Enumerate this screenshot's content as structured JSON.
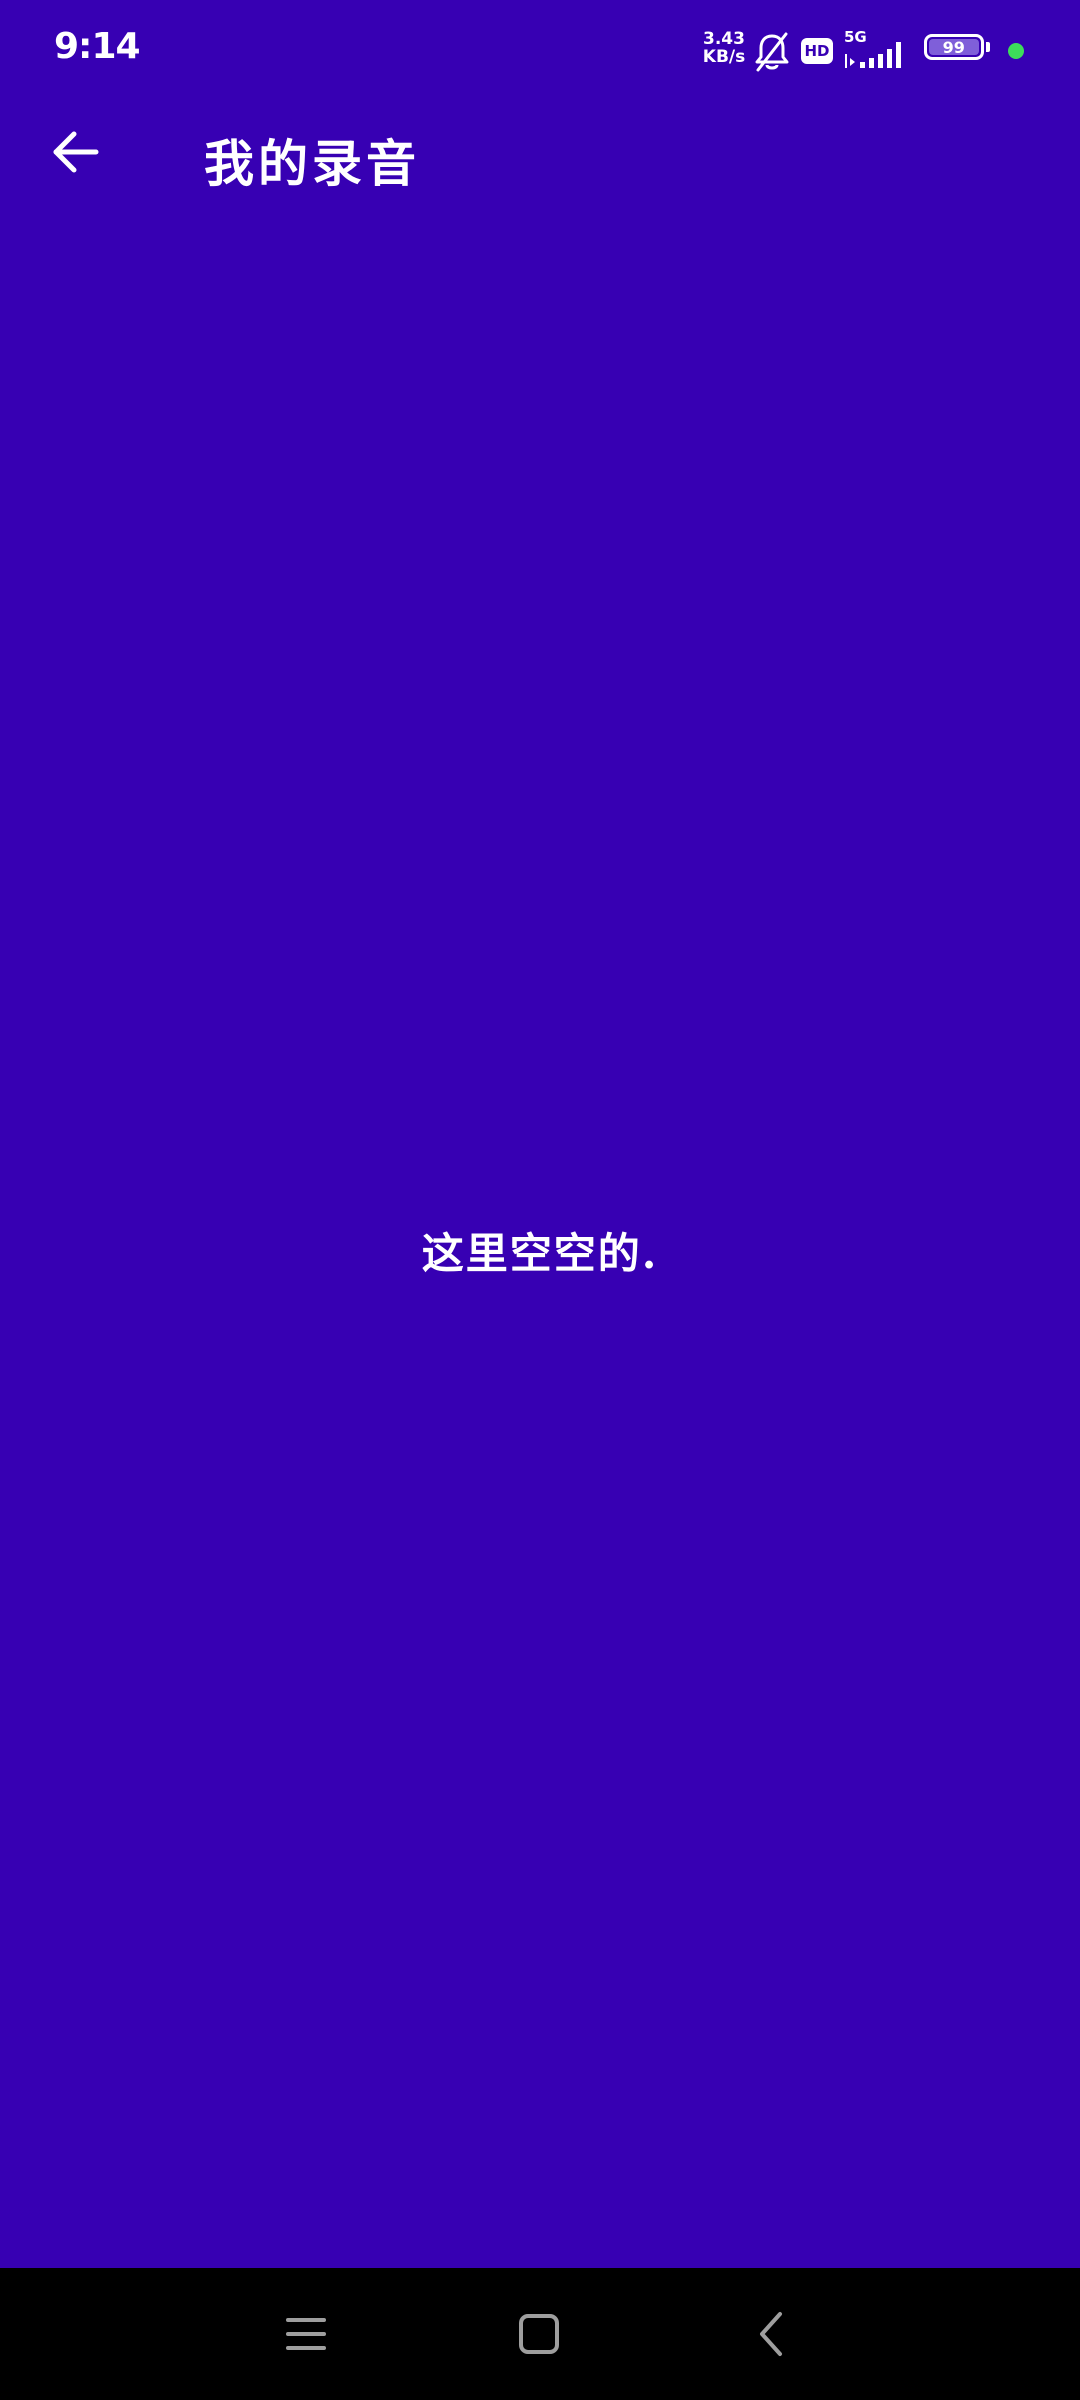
{
  "status_bar": {
    "time": "9:14",
    "net_speed_value": "3.43",
    "net_speed_unit": "KB/s",
    "hd_label": "HD",
    "network_type": "5G",
    "battery_level": "99",
    "icons": [
      "notifications-muted-icon",
      "hd-icon",
      "signal-icon",
      "battery-icon",
      "status-dot"
    ],
    "dot_color": "#3ddc5a"
  },
  "app_bar": {
    "title": "我的录音",
    "back_icon": "arrow-left-icon"
  },
  "main": {
    "empty_message": "这里空空的."
  },
  "nav_bar": {
    "buttons": [
      "menu-icon",
      "home-icon",
      "back-icon"
    ]
  },
  "colors": {
    "background": "#3700B3",
    "nav_background": "#000000",
    "text": "#ffffff"
  }
}
